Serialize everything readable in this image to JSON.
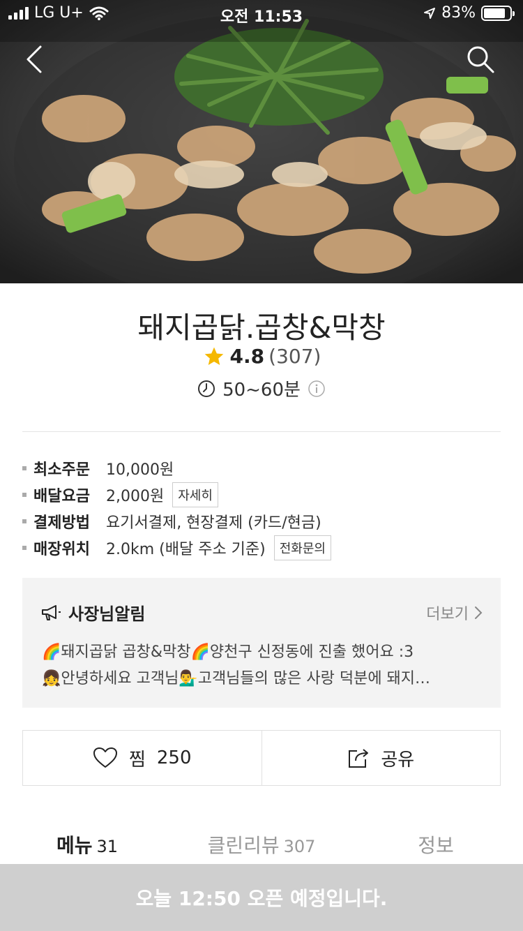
{
  "status_bar": {
    "carrier": "LG U+",
    "time": "오전 11:53",
    "battery": "83%",
    "battery_level": 0.83
  },
  "hero": {
    "image": "dish-photo"
  },
  "store": {
    "name": "돼지곱닭.곱창&막창",
    "rating": "4.8",
    "review_count": "(307)",
    "eta": "50~60분"
  },
  "info": [
    {
      "label": "최소주문",
      "value": "10,000원"
    },
    {
      "label": "배달요금",
      "value": "2,000원",
      "chip": "자세히"
    },
    {
      "label": "결제방법",
      "value": "요기서결제, 현장결제 (카드/현금)"
    },
    {
      "label": "매장위치",
      "value": "2.0km (배달 주소 기준)",
      "chip": "전화문의"
    }
  ],
  "notice": {
    "title": "사장님알림",
    "more": "더보기",
    "line1": "🌈돼지곱닭 곱창&막창🌈양천구 신정동에 진출 했어요 :3",
    "line2": "👧안녕하세요 고객님💁‍♂️고객님들의 많은 사랑 덕분에 돼지…"
  },
  "actions": {
    "like_label": "찜",
    "like_count": "250",
    "share_label": "공유"
  },
  "tabs": [
    {
      "label": "메뉴",
      "count": "31"
    },
    {
      "label": "클린리뷰",
      "count": "307"
    },
    {
      "label": "정보",
      "count": ""
    }
  ],
  "bottom_banner": "오늘 12:50 오픈 예정입니다.",
  "colors": {
    "star": "#F5B800",
    "bottom_bar": "#CFCFCF",
    "notice_bg": "#F3F3F3"
  }
}
